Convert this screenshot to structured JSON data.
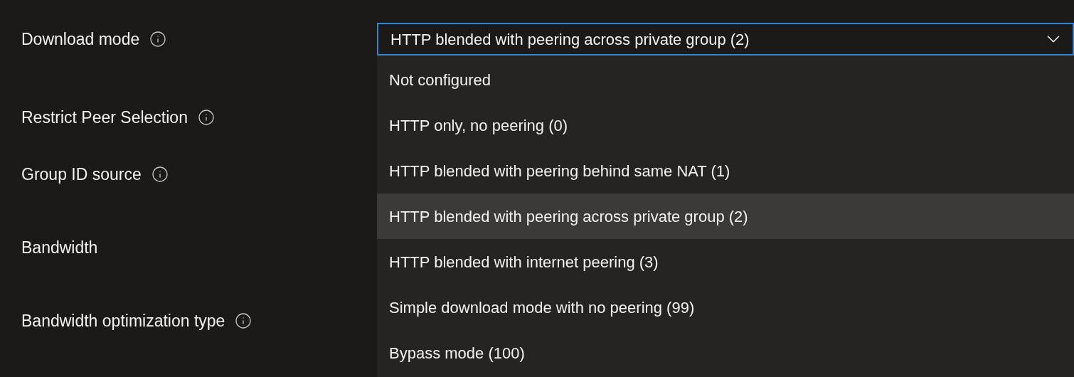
{
  "fields": [
    {
      "label": "Download mode",
      "info_icon": true
    },
    {
      "label": "Restrict Peer Selection",
      "info_icon": true
    },
    {
      "label": "Group ID source",
      "info_icon": true
    },
    {
      "label": "Bandwidth",
      "info_icon": false
    },
    {
      "label": "Bandwidth optimization type",
      "info_icon": true
    }
  ],
  "dropdown": {
    "value": "HTTP blended with peering across private group (2)",
    "expanded": true,
    "options": [
      {
        "label": "Not configured",
        "selected": false
      },
      {
        "label": "HTTP only, no peering (0)",
        "selected": false
      },
      {
        "label": "HTTP blended with peering behind same NAT (1)",
        "selected": false
      },
      {
        "label": "HTTP blended with peering across private group (2)",
        "selected": true
      },
      {
        "label": "HTTP blended with internet peering (3)",
        "selected": false
      },
      {
        "label": "Simple download mode with no peering (99)",
        "selected": false
      },
      {
        "label": "Bypass mode (100)",
        "selected": false
      }
    ]
  }
}
